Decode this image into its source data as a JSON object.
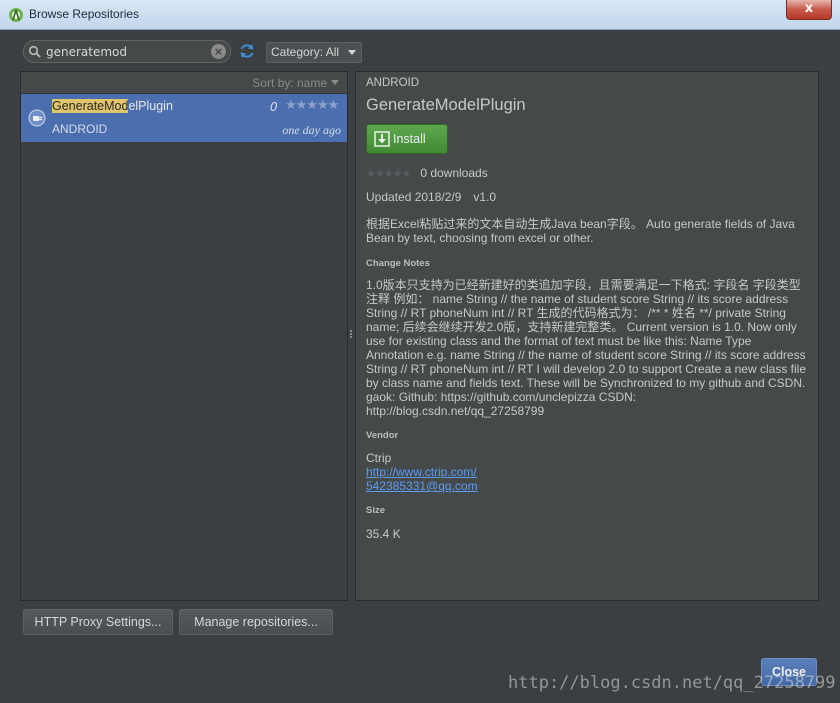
{
  "window": {
    "title": "Browse Repositories",
    "close_glyph": "x"
  },
  "search": {
    "value": "generatemod",
    "clear_glyph": "×"
  },
  "category_select": {
    "value": "Category: All"
  },
  "list": {
    "sort_label": "Sort by: name",
    "items": [
      {
        "name_highlight": "GenerateMod",
        "name_rest": "elPlugin",
        "category": "ANDROID",
        "downloads": "0",
        "date": "one day ago",
        "stars": "★★★★★"
      }
    ]
  },
  "details": {
    "category": "ANDROID",
    "name": "GenerateModelPlugin",
    "install_label": "Install",
    "stars": "★★★★★",
    "downloads": "0 downloads",
    "updated": "Updated 2018/2/9",
    "version": "v1.0",
    "description": "根据Excel粘贴过来的文本自动生成Java bean字段。 Auto generate fields of Java Bean by text, choosing from excel or other.",
    "change_notes_heading": "Change Notes",
    "change_notes": "1.0版本只支持为已经新建好的类追加字段，且需要满足一下格式: 字段名 字段类型 注释 例如： name String // the name of student score String // its score address String // RT phoneNum int // RT 生成的代码格式为： /** * 姓名 **/ private String name; 后续会继续开发2.0版，支持新建完整类。 Current version is 1.0. Now only use for existing class and the format of text must be like this: Name Type Annotation e.g. name String // the name of student score String // its score address String // RT phoneNum int // RT I will develop 2.0 to support Create a new class file by class name and fields text. These will be Synchronized to my github and CSDN. gaok: Github: https://github.com/unclepizza CSDN: http://blog.csdn.net/qq_27258799",
    "vendor_heading": "Vendor",
    "vendor_name": "Ctrip",
    "vendor_url": "http://www.ctrip.com/",
    "vendor_email": "542385331@qq.com",
    "size_heading": "Size",
    "size": "35.4 K"
  },
  "buttons": {
    "http_proxy": "HTTP Proxy Settings...",
    "manage_repos": "Manage repositories...",
    "close": "Close"
  },
  "watermark": "http://blog.csdn.net/qq_27258799",
  "colors": {
    "selection": "#4b6eaf",
    "install_green": "#4e9a41",
    "link": "#589df6",
    "highlight": "#e1c56b"
  }
}
